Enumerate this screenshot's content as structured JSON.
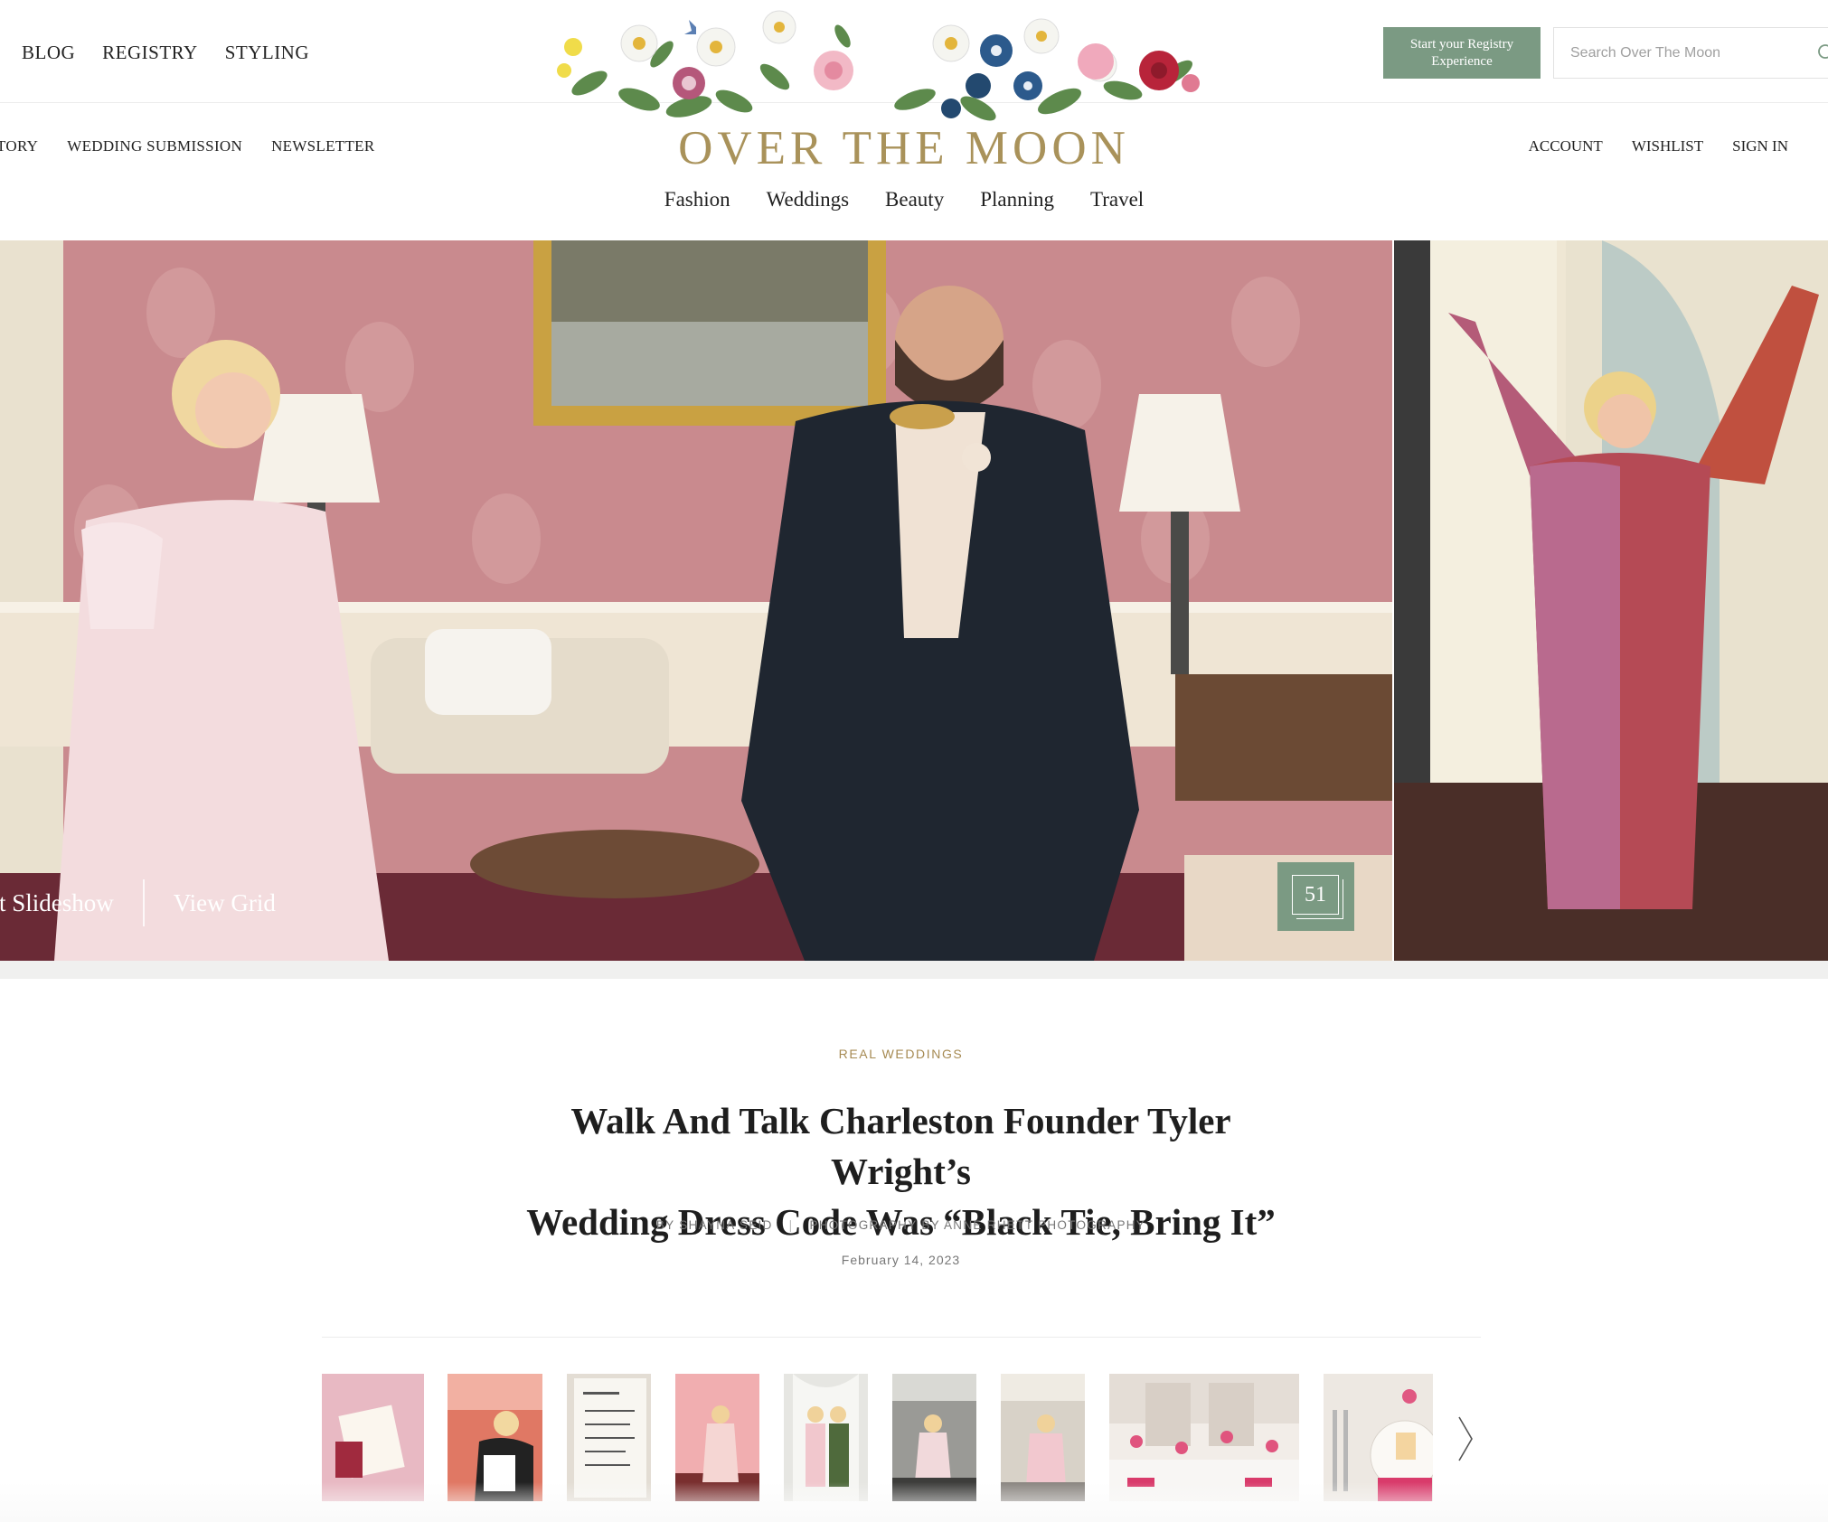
{
  "top_nav": [
    "BLOG",
    "REGISTRY",
    "STYLING"
  ],
  "sub_nav": [
    "TORY",
    "WEDDING SUBMISSION",
    "NEWSLETTER"
  ],
  "account_nav": [
    "ACCOUNT",
    "WISHLIST",
    "SIGN IN"
  ],
  "registry_button": "Start your Registry Experience",
  "search": {
    "placeholder": "Search Over The Moon"
  },
  "logo": {
    "text": "OVER THE MOON"
  },
  "categories": [
    "Fashion",
    "Weddings",
    "Beauty",
    "Planning",
    "Travel"
  ],
  "hero": {
    "slideshow_label": "rt Slideshow",
    "grid_label": "View Grid",
    "photo_count": "51"
  },
  "article": {
    "category": "REAL WEDDINGS",
    "title_line1": "Walk And Talk Charleston Founder Tyler Wright’s",
    "title_line2": "Wedding Dress Code Was “Black Tie, Bring It”",
    "author": "BY SHAYNA SEID",
    "photographer": "PHOTOGRAPHY BY ANNE RHETT PHOTOGRAPHY",
    "date": "February 14, 2023"
  },
  "colors": {
    "accent_green": "#7b9a83",
    "logo_gold": "#a9925a",
    "category_gold": "#a68a52"
  },
  "icons": [
    "search-icon",
    "photo-stack-icon",
    "chevron-right-icon"
  ]
}
